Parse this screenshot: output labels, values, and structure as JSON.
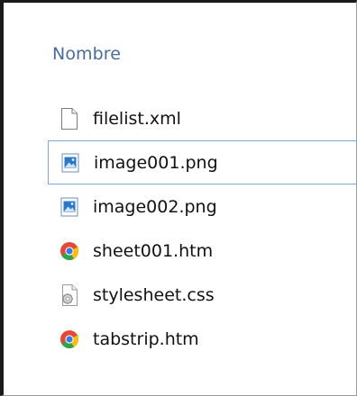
{
  "columns": {
    "name_header": "Nombre"
  },
  "files": [
    {
      "name": "filelist.xml",
      "icon": "blank-document-icon"
    },
    {
      "name": "image001.png",
      "icon": "image-file-icon",
      "focused": true
    },
    {
      "name": "image002.png",
      "icon": "image-file-icon"
    },
    {
      "name": "sheet001.htm",
      "icon": "chrome-icon"
    },
    {
      "name": "stylesheet.css",
      "icon": "stylesheet-file-icon"
    },
    {
      "name": "tabstrip.htm",
      "icon": "chrome-icon"
    }
  ],
  "colors": {
    "header_text": "#4b6c98",
    "focus_border": "#7fa8d8",
    "image_icon_blue": "#2a79c8",
    "chrome_red": "#e34a33",
    "chrome_yellow": "#f4c20d",
    "chrome_green": "#2ea44f",
    "chrome_blue": "#3b78e7"
  }
}
